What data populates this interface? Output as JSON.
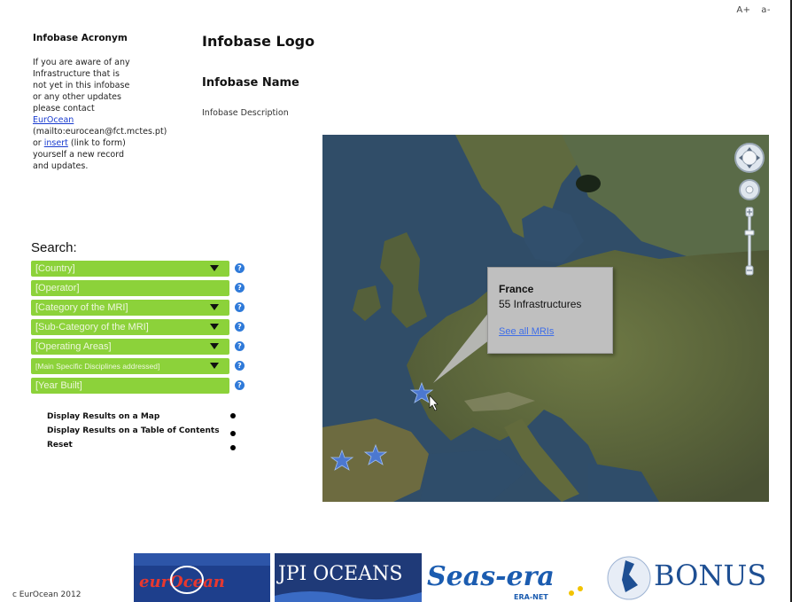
{
  "header": {
    "font_larger": "A+",
    "font_smaller": "a-"
  },
  "left": {
    "acronym": "Infobase Acronym",
    "info_pre": "If you are aware of any Infrastructure that is not yet in this infobase or any other updates please contact ",
    "eurocean_link": "EurOcean",
    "info_mid": " (mailto:eurocean@fct.mctes.pt) or ",
    "insert_link": "insert",
    "info_post": " (link to form) yourself a new record and updates."
  },
  "main": {
    "logo": "Infobase Logo",
    "name": "Infobase Name",
    "description": "Infobase Description"
  },
  "search": {
    "label": "Search:",
    "fields": [
      {
        "label": "[Country]",
        "dropdown": true
      },
      {
        "label": "[Operator]",
        "dropdown": false
      },
      {
        "label": "[Category of the MRI]",
        "dropdown": true
      },
      {
        "label": "[Sub-Category of the MRI]",
        "dropdown": true
      },
      {
        "label": "[Operating Areas]",
        "dropdown": true
      },
      {
        "label": "[Main Specific Disciplines addressed]",
        "dropdown": true
      },
      {
        "label": "[Year Built]",
        "dropdown": false
      }
    ],
    "help_symbol": "?"
  },
  "options": {
    "map": "Display Results on a Map",
    "table": "Display Results on a Table of Contents",
    "reset": "Reset"
  },
  "map_popup": {
    "country": "France",
    "count": "55 Infrastructures",
    "link": "See all MRIs"
  },
  "footer": {
    "copyright": "c EurOcean 2012",
    "partners": [
      "eurOcean",
      "JPI OCEANS",
      "Seas-era",
      "ERA-NET",
      "BONUS"
    ]
  },
  "colors": {
    "field_green": "#8cd23a",
    "help_blue": "#2f7ad9",
    "link_blue": "#1a3ccf",
    "map_sea": "#2f4b63"
  }
}
